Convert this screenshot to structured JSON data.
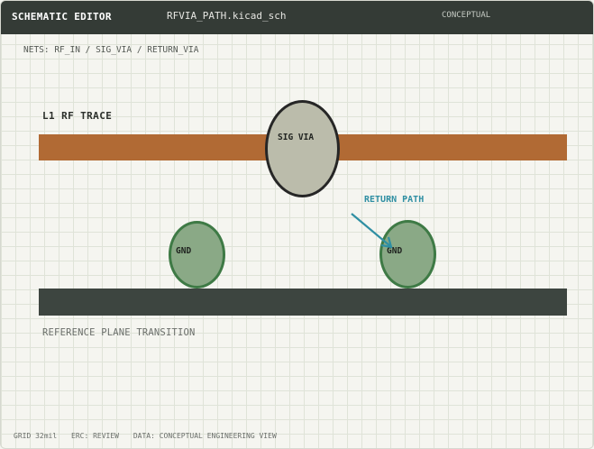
{
  "titlebar": {
    "app_name": "SCHEMATIC EDITOR",
    "file_name": "RFVIA_PATH.kicad_sch",
    "mode": "CONCEPTUAL"
  },
  "nets_line": "NETS: RF_IN / SIG_VIA / RETURN_VIA",
  "canvas": {
    "layer_label": "L1 RF TRACE",
    "sig_via_label": "SIG VIA",
    "gnd_left_label": "GND",
    "gnd_right_label": "GND",
    "return_path_label": "RETURN PATH",
    "plane_caption": "REFERENCE PLANE TRANSITION"
  },
  "colors": {
    "trace": "#b16a34",
    "plane": "#3d4540",
    "gnd_via_fill": "#8aa986",
    "gnd_via_stroke": "#3e7a45",
    "sig_via_fill": "#bbbcab",
    "return_path": "#2f8fa3"
  },
  "status": {
    "grid": "GRID 32mil",
    "erc": "ERC: REVIEW",
    "data": "DATA: CONCEPTUAL ENGINEERING VIEW"
  }
}
